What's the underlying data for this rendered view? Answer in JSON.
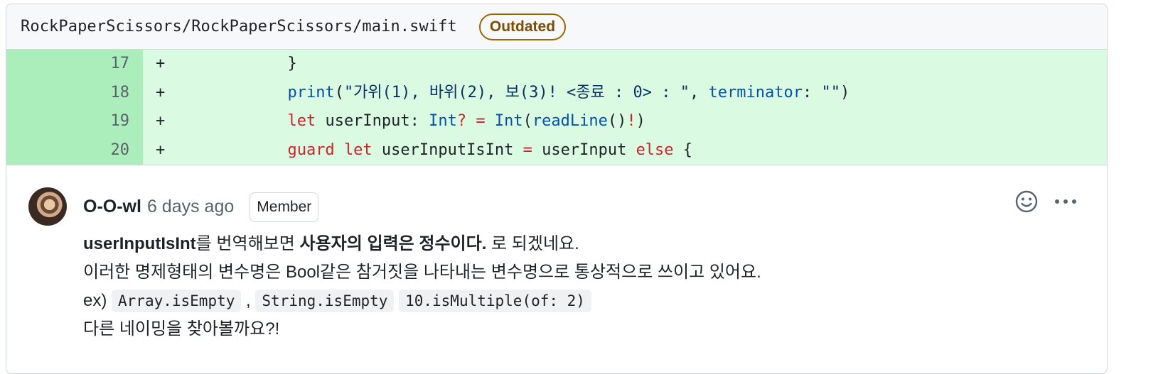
{
  "file": {
    "path": "RockPaperScissors/RockPaperScissors/main.swift",
    "badge": "Outdated"
  },
  "diff": {
    "rows": [
      {
        "line": "17",
        "sign": "+",
        "tokens": [
          [
            "p",
            "        }"
          ]
        ]
      },
      {
        "line": "18",
        "sign": "+",
        "tokens": [
          [
            "p",
            "        "
          ],
          [
            "f",
            "print"
          ],
          [
            "p",
            "("
          ],
          [
            "s",
            "\"가위(1), 바위(2), 보(3)! <종료 : 0> : \""
          ],
          [
            "p",
            ", "
          ],
          [
            "f",
            "terminator"
          ],
          [
            "p",
            ": "
          ],
          [
            "s",
            "\"\""
          ],
          [
            "p",
            ")"
          ]
        ]
      },
      {
        "line": "19",
        "sign": "+",
        "tokens": [
          [
            "p",
            "        "
          ],
          [
            "k",
            "let"
          ],
          [
            "p",
            " userInput: "
          ],
          [
            "f",
            "Int"
          ],
          [
            "k",
            "?"
          ],
          [
            "p",
            " "
          ],
          [
            "k",
            "="
          ],
          [
            "p",
            " "
          ],
          [
            "f",
            "Int"
          ],
          [
            "p",
            "("
          ],
          [
            "f",
            "readLine"
          ],
          [
            "p",
            "()"
          ],
          [
            "k",
            "!"
          ],
          [
            "p",
            ")"
          ]
        ]
      },
      {
        "line": "20",
        "sign": "+",
        "tokens": [
          [
            "p",
            "        "
          ],
          [
            "k",
            "guard"
          ],
          [
            "p",
            " "
          ],
          [
            "k",
            "let"
          ],
          [
            "p",
            " userInputIsInt "
          ],
          [
            "k",
            "="
          ],
          [
            "p",
            " userInput "
          ],
          [
            "k",
            "else"
          ],
          [
            "p",
            " {"
          ]
        ]
      }
    ]
  },
  "comment": {
    "author": "O-O-wl",
    "time": "6 days ago",
    "role": "Member",
    "icons": {
      "reaction": "smiley-icon",
      "more": "kebab-horizontal-icon"
    },
    "line1": {
      "bold1": "userInputIsInt",
      "text1": "를 번역해보면 ",
      "bold2": "사용자의 입력은 정수이다.",
      "text2": " 로 되겠네요."
    },
    "line2": "이러한 명제형태의 변수명은 Bool같은 참거짓을 나타내는 변수명으로 통상적으로 쓰이고 있어요.",
    "line3": {
      "prefix": "ex) ",
      "code1": "Array.isEmpty",
      "sep": " , ",
      "code2": "String.isEmpty",
      "code3": "10.isMultiple(of: 2)"
    },
    "line4": "다른 네이밍을 찾아볼까요?!"
  }
}
